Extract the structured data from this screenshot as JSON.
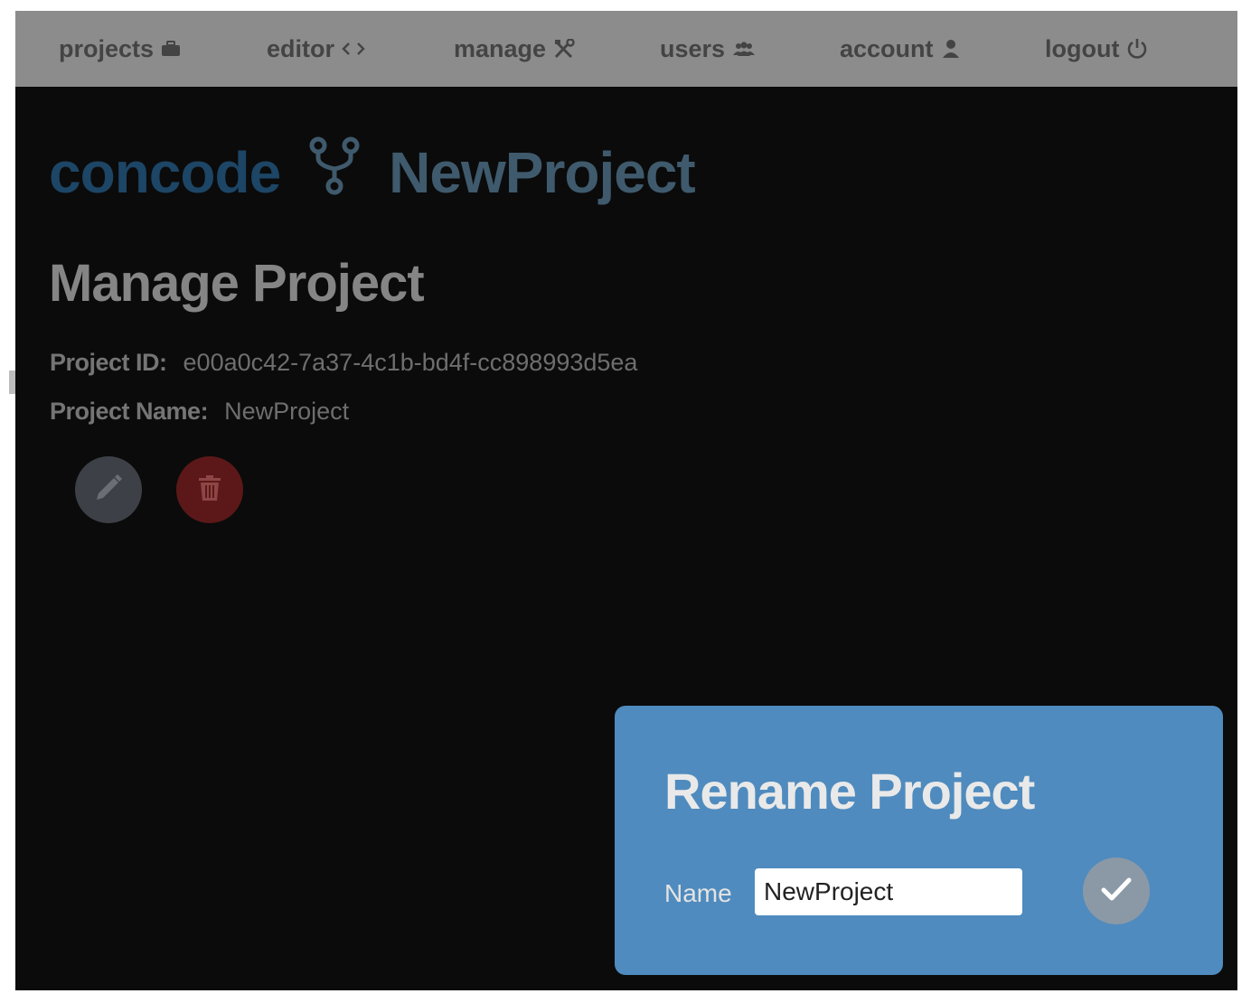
{
  "nav": {
    "items": [
      {
        "label": "projects",
        "icon": "briefcase-icon"
      },
      {
        "label": "editor",
        "icon": "code-icon"
      },
      {
        "label": "manage",
        "icon": "wrench-icon"
      },
      {
        "label": "users",
        "icon": "users-icon"
      },
      {
        "label": "account",
        "icon": "user-icon"
      },
      {
        "label": "logout",
        "icon": "power-icon"
      }
    ]
  },
  "brand": {
    "app_name": "concode",
    "project_name": "NewProject",
    "icon": "code-fork-icon"
  },
  "page": {
    "title": "Manage Project",
    "project_id_label": "Project ID:",
    "project_id_value": "e00a0c42-7a37-4c1b-bd4f-cc898993d5ea",
    "project_name_label": "Project Name:",
    "project_name_value": "NewProject"
  },
  "actions": {
    "edit_icon": "pencil-icon",
    "delete_icon": "trash-icon"
  },
  "modal": {
    "title": "Rename Project",
    "name_label": "Name",
    "name_value": "NewProject",
    "confirm_icon": "checkmark-icon"
  },
  "colors": {
    "navbar": "#8c8c8c",
    "background": "#0b0b0b",
    "modal": "#4f8bbe",
    "delete": "#5c1818"
  }
}
